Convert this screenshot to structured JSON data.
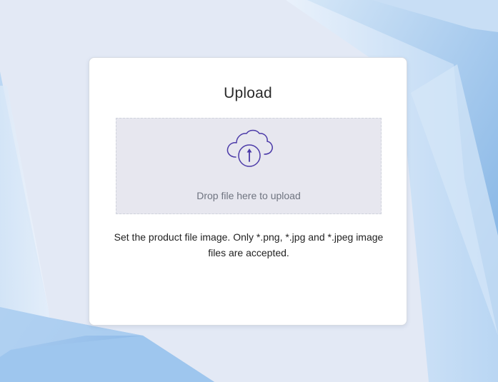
{
  "upload": {
    "title": "Upload",
    "dropzone_text": "Drop file here to upload",
    "help_text": "Set the product file image. Only *.png, *.jpg and *.jpeg image files are accepted.",
    "icon": "cloud-upload-icon"
  },
  "colors": {
    "accent": "#4b3aa8",
    "background": "#e3e9f5",
    "card": "#ffffff",
    "dropzone": "#e7e7ef"
  }
}
